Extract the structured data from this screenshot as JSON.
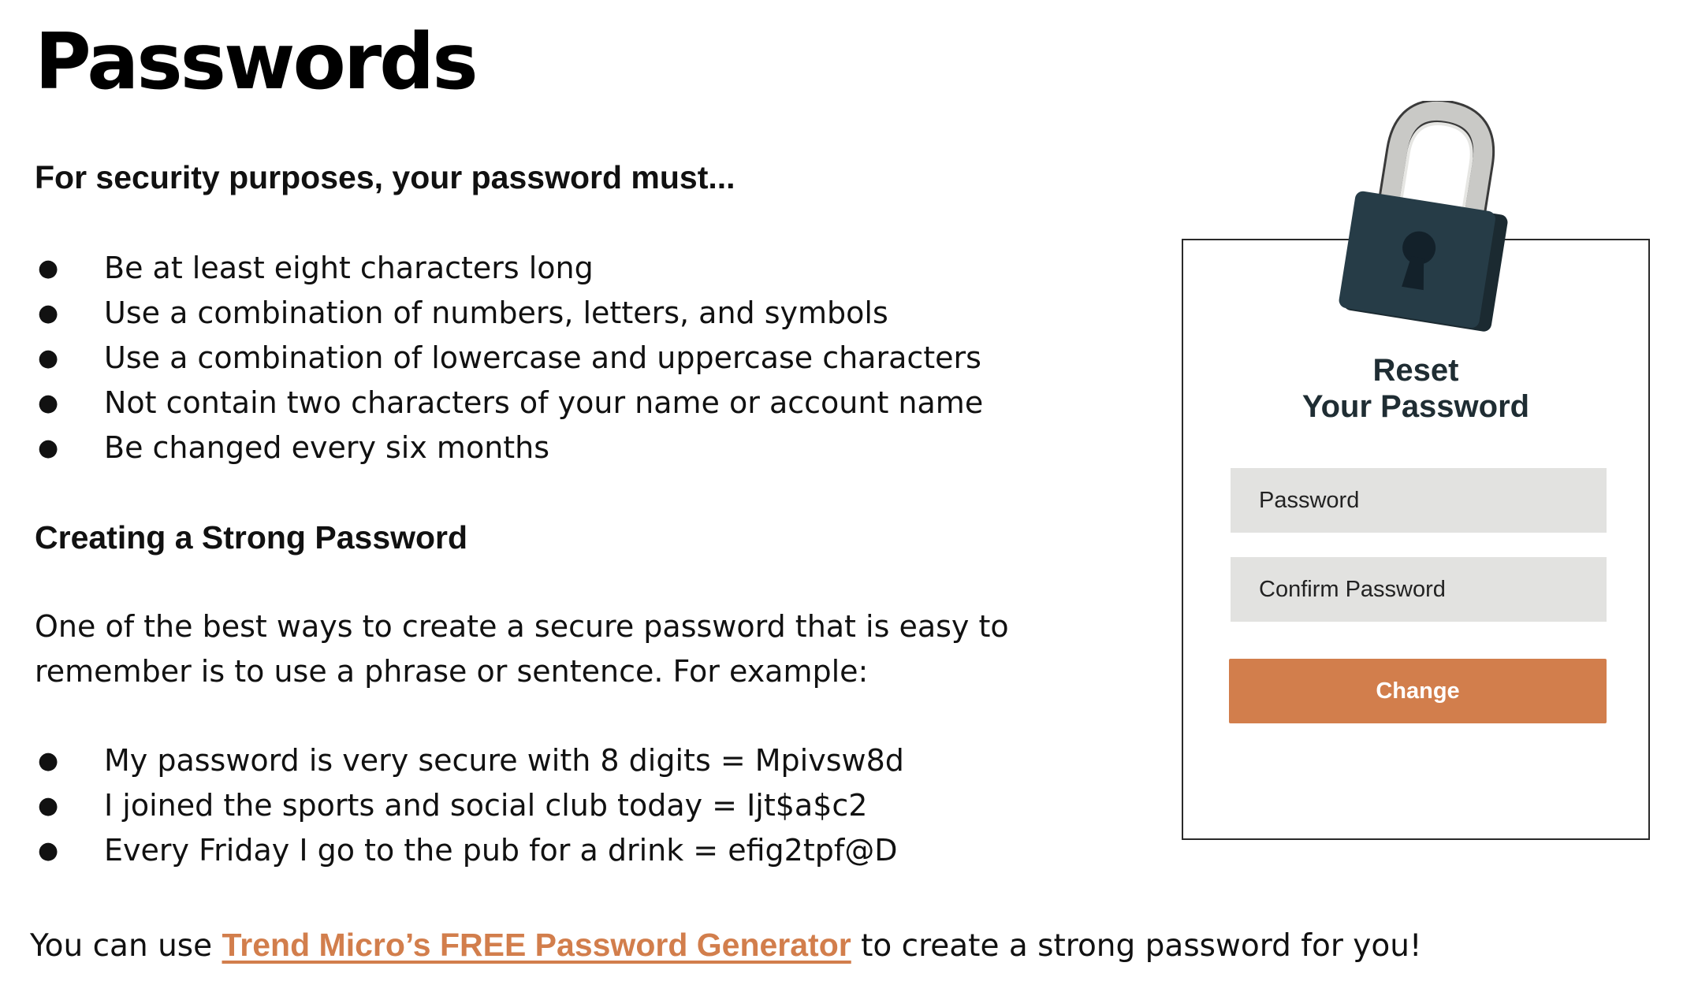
{
  "page": {
    "title": "Passwords"
  },
  "requirements": {
    "heading": "For security purposes, your password must...",
    "bullet_glyph": "●",
    "items": [
      "Be at least eight characters long",
      "Use a combination of numbers, letters, and symbols",
      "Use a combination of lowercase and uppercase characters",
      "Not contain two characters of your name or account name",
      "Be changed every six months"
    ]
  },
  "strong": {
    "heading": "Creating a Strong Password",
    "paragraph_line1": "One of the best ways to create a secure password that is easy to",
    "paragraph_line2": "remember is to use a phrase or sentence. For example:",
    "examples": [
      "My password is very secure with 8 digits = Mpivsw8d",
      "I joined the sports and social club today = Ijt$a$c2",
      "Every Friday I go to the pub for a drink = efig2tpf@D"
    ]
  },
  "footer": {
    "prefix": "You can use ",
    "link_text": "Trend Micro’s FREE Password Generator",
    "suffix": " to create a strong password for you!"
  },
  "reset_card": {
    "title_line1": "Reset",
    "title_line2": "Your Password",
    "password_placeholder": "Password",
    "confirm_placeholder": "Confirm Password",
    "button_label": "Change",
    "icon": "padlock-icon"
  },
  "colors": {
    "accent": "#d27e4c",
    "lock_body": "#263c47",
    "lock_shackle": "#c9c9c6",
    "field_bg": "#e2e2e0",
    "title_text": "#1f2d33"
  }
}
